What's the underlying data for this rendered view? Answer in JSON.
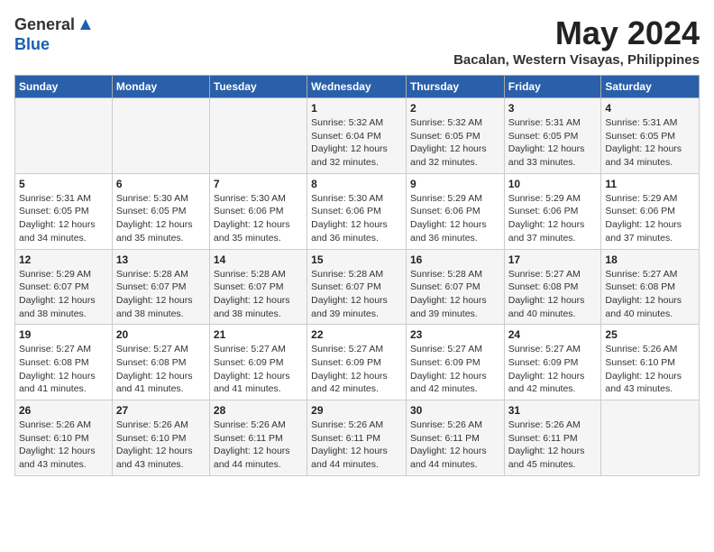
{
  "header": {
    "logo_general": "General",
    "logo_blue": "Blue",
    "month_title": "May 2024",
    "location": "Bacalan, Western Visayas, Philippines"
  },
  "calendar": {
    "days_of_week": [
      "Sunday",
      "Monday",
      "Tuesday",
      "Wednesday",
      "Thursday",
      "Friday",
      "Saturday"
    ],
    "weeks": [
      [
        {
          "day": "",
          "info": ""
        },
        {
          "day": "",
          "info": ""
        },
        {
          "day": "",
          "info": ""
        },
        {
          "day": "1",
          "info": "Sunrise: 5:32 AM\nSunset: 6:04 PM\nDaylight: 12 hours and 32 minutes."
        },
        {
          "day": "2",
          "info": "Sunrise: 5:32 AM\nSunset: 6:05 PM\nDaylight: 12 hours and 32 minutes."
        },
        {
          "day": "3",
          "info": "Sunrise: 5:31 AM\nSunset: 6:05 PM\nDaylight: 12 hours and 33 minutes."
        },
        {
          "day": "4",
          "info": "Sunrise: 5:31 AM\nSunset: 6:05 PM\nDaylight: 12 hours and 34 minutes."
        }
      ],
      [
        {
          "day": "5",
          "info": "Sunrise: 5:31 AM\nSunset: 6:05 PM\nDaylight: 12 hours and 34 minutes."
        },
        {
          "day": "6",
          "info": "Sunrise: 5:30 AM\nSunset: 6:05 PM\nDaylight: 12 hours and 35 minutes."
        },
        {
          "day": "7",
          "info": "Sunrise: 5:30 AM\nSunset: 6:06 PM\nDaylight: 12 hours and 35 minutes."
        },
        {
          "day": "8",
          "info": "Sunrise: 5:30 AM\nSunset: 6:06 PM\nDaylight: 12 hours and 36 minutes."
        },
        {
          "day": "9",
          "info": "Sunrise: 5:29 AM\nSunset: 6:06 PM\nDaylight: 12 hours and 36 minutes."
        },
        {
          "day": "10",
          "info": "Sunrise: 5:29 AM\nSunset: 6:06 PM\nDaylight: 12 hours and 37 minutes."
        },
        {
          "day": "11",
          "info": "Sunrise: 5:29 AM\nSunset: 6:06 PM\nDaylight: 12 hours and 37 minutes."
        }
      ],
      [
        {
          "day": "12",
          "info": "Sunrise: 5:29 AM\nSunset: 6:07 PM\nDaylight: 12 hours and 38 minutes."
        },
        {
          "day": "13",
          "info": "Sunrise: 5:28 AM\nSunset: 6:07 PM\nDaylight: 12 hours and 38 minutes."
        },
        {
          "day": "14",
          "info": "Sunrise: 5:28 AM\nSunset: 6:07 PM\nDaylight: 12 hours and 38 minutes."
        },
        {
          "day": "15",
          "info": "Sunrise: 5:28 AM\nSunset: 6:07 PM\nDaylight: 12 hours and 39 minutes."
        },
        {
          "day": "16",
          "info": "Sunrise: 5:28 AM\nSunset: 6:07 PM\nDaylight: 12 hours and 39 minutes."
        },
        {
          "day": "17",
          "info": "Sunrise: 5:27 AM\nSunset: 6:08 PM\nDaylight: 12 hours and 40 minutes."
        },
        {
          "day": "18",
          "info": "Sunrise: 5:27 AM\nSunset: 6:08 PM\nDaylight: 12 hours and 40 minutes."
        }
      ],
      [
        {
          "day": "19",
          "info": "Sunrise: 5:27 AM\nSunset: 6:08 PM\nDaylight: 12 hours and 41 minutes."
        },
        {
          "day": "20",
          "info": "Sunrise: 5:27 AM\nSunset: 6:08 PM\nDaylight: 12 hours and 41 minutes."
        },
        {
          "day": "21",
          "info": "Sunrise: 5:27 AM\nSunset: 6:09 PM\nDaylight: 12 hours and 41 minutes."
        },
        {
          "day": "22",
          "info": "Sunrise: 5:27 AM\nSunset: 6:09 PM\nDaylight: 12 hours and 42 minutes."
        },
        {
          "day": "23",
          "info": "Sunrise: 5:27 AM\nSunset: 6:09 PM\nDaylight: 12 hours and 42 minutes."
        },
        {
          "day": "24",
          "info": "Sunrise: 5:27 AM\nSunset: 6:09 PM\nDaylight: 12 hours and 42 minutes."
        },
        {
          "day": "25",
          "info": "Sunrise: 5:26 AM\nSunset: 6:10 PM\nDaylight: 12 hours and 43 minutes."
        }
      ],
      [
        {
          "day": "26",
          "info": "Sunrise: 5:26 AM\nSunset: 6:10 PM\nDaylight: 12 hours and 43 minutes."
        },
        {
          "day": "27",
          "info": "Sunrise: 5:26 AM\nSunset: 6:10 PM\nDaylight: 12 hours and 43 minutes."
        },
        {
          "day": "28",
          "info": "Sunrise: 5:26 AM\nSunset: 6:11 PM\nDaylight: 12 hours and 44 minutes."
        },
        {
          "day": "29",
          "info": "Sunrise: 5:26 AM\nSunset: 6:11 PM\nDaylight: 12 hours and 44 minutes."
        },
        {
          "day": "30",
          "info": "Sunrise: 5:26 AM\nSunset: 6:11 PM\nDaylight: 12 hours and 44 minutes."
        },
        {
          "day": "31",
          "info": "Sunrise: 5:26 AM\nSunset: 6:11 PM\nDaylight: 12 hours and 45 minutes."
        },
        {
          "day": "",
          "info": ""
        }
      ]
    ]
  }
}
